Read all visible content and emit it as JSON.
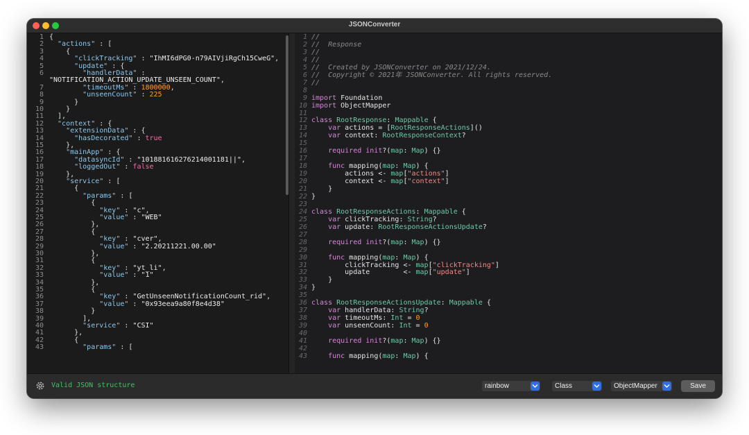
{
  "window": {
    "title": "JSONConverter"
  },
  "json_lines": [
    {
      "n": "1",
      "tokens": [
        {
          "c": "pun",
          "t": "{"
        }
      ]
    },
    {
      "n": "2",
      "tokens": [
        {
          "c": "key",
          "t": "  \"actions\""
        },
        {
          "c": "pun",
          "t": " : ["
        }
      ]
    },
    {
      "n": "3",
      "tokens": [
        {
          "c": "pun",
          "t": "    {"
        }
      ]
    },
    {
      "n": "4",
      "tokens": [
        {
          "c": "key",
          "t": "      \"clickTracking\""
        },
        {
          "c": "pun",
          "t": " : "
        },
        {
          "c": "str",
          "t": "\"IhMI6dPG0-n79AIVjiRgCh15CweG\""
        },
        {
          "c": "pun",
          "t": ","
        }
      ]
    },
    {
      "n": "5",
      "tokens": [
        {
          "c": "key",
          "t": "      \"update\""
        },
        {
          "c": "pun",
          "t": " : {"
        }
      ]
    },
    {
      "n": "6",
      "tokens": [
        {
          "c": "key",
          "t": "        \"handlerData\""
        },
        {
          "c": "pun",
          "t": " :"
        }
      ]
    },
    {
      "n": "",
      "tokens": [
        {
          "c": "str",
          "t": "\"NOTIFICATION_ACTION_UPDATE_UNSEEN_COUNT\""
        },
        {
          "c": "pun",
          "t": ","
        }
      ]
    },
    {
      "n": "7",
      "tokens": [
        {
          "c": "key",
          "t": "        \"timeoutMs\""
        },
        {
          "c": "pun",
          "t": " : "
        },
        {
          "c": "num",
          "t": "1800000"
        },
        {
          "c": "pun",
          "t": ","
        }
      ]
    },
    {
      "n": "8",
      "tokens": [
        {
          "c": "key",
          "t": "        \"unseenCount\""
        },
        {
          "c": "pun",
          "t": " : "
        },
        {
          "c": "num",
          "t": "225"
        }
      ]
    },
    {
      "n": "9",
      "tokens": [
        {
          "c": "pun",
          "t": "      }"
        }
      ]
    },
    {
      "n": "10",
      "tokens": [
        {
          "c": "pun",
          "t": "    }"
        }
      ]
    },
    {
      "n": "11",
      "tokens": [
        {
          "c": "pun",
          "t": "  ],"
        }
      ]
    },
    {
      "n": "12",
      "tokens": [
        {
          "c": "key",
          "t": "  \"context\""
        },
        {
          "c": "pun",
          "t": " : {"
        }
      ]
    },
    {
      "n": "13",
      "tokens": [
        {
          "c": "key",
          "t": "    \"extensionData\""
        },
        {
          "c": "pun",
          "t": " : {"
        }
      ]
    },
    {
      "n": "14",
      "tokens": [
        {
          "c": "key",
          "t": "      \"hasDecorated\""
        },
        {
          "c": "pun",
          "t": " : "
        },
        {
          "c": "lit",
          "t": "true"
        }
      ]
    },
    {
      "n": "15",
      "tokens": [
        {
          "c": "pun",
          "t": "    },"
        }
      ]
    },
    {
      "n": "16",
      "tokens": [
        {
          "c": "key",
          "t": "    \"mainApp\""
        },
        {
          "c": "pun",
          "t": " : {"
        }
      ]
    },
    {
      "n": "17",
      "tokens": [
        {
          "c": "key",
          "t": "      \"datasyncId\""
        },
        {
          "c": "pun",
          "t": " : "
        },
        {
          "c": "str",
          "t": "\"101881616276214001181||\""
        },
        {
          "c": "pun",
          "t": ","
        }
      ]
    },
    {
      "n": "18",
      "tokens": [
        {
          "c": "key",
          "t": "      \"loggedOut\""
        },
        {
          "c": "pun",
          "t": " : "
        },
        {
          "c": "lit",
          "t": "false"
        }
      ]
    },
    {
      "n": "19",
      "tokens": [
        {
          "c": "pun",
          "t": "    },"
        }
      ]
    },
    {
      "n": "20",
      "tokens": [
        {
          "c": "key",
          "t": "    \"service\""
        },
        {
          "c": "pun",
          "t": " : ["
        }
      ]
    },
    {
      "n": "21",
      "tokens": [
        {
          "c": "pun",
          "t": "      {"
        }
      ]
    },
    {
      "n": "22",
      "tokens": [
        {
          "c": "key",
          "t": "        \"params\""
        },
        {
          "c": "pun",
          "t": " : ["
        }
      ]
    },
    {
      "n": "23",
      "tokens": [
        {
          "c": "pun",
          "t": "          {"
        }
      ]
    },
    {
      "n": "24",
      "tokens": [
        {
          "c": "key",
          "t": "            \"key\""
        },
        {
          "c": "pun",
          "t": " : "
        },
        {
          "c": "str",
          "t": "\"c\""
        },
        {
          "c": "pun",
          "t": ","
        }
      ]
    },
    {
      "n": "25",
      "tokens": [
        {
          "c": "key",
          "t": "            \"value\""
        },
        {
          "c": "pun",
          "t": " : "
        },
        {
          "c": "str",
          "t": "\"WEB\""
        }
      ]
    },
    {
      "n": "26",
      "tokens": [
        {
          "c": "pun",
          "t": "          },"
        }
      ]
    },
    {
      "n": "27",
      "tokens": [
        {
          "c": "pun",
          "t": "          {"
        }
      ]
    },
    {
      "n": "28",
      "tokens": [
        {
          "c": "key",
          "t": "            \"key\""
        },
        {
          "c": "pun",
          "t": " : "
        },
        {
          "c": "str",
          "t": "\"cver\""
        },
        {
          "c": "pun",
          "t": ","
        }
      ]
    },
    {
      "n": "29",
      "tokens": [
        {
          "c": "key",
          "t": "            \"value\""
        },
        {
          "c": "pun",
          "t": " : "
        },
        {
          "c": "str",
          "t": "\"2.20211221.00.00\""
        }
      ]
    },
    {
      "n": "30",
      "tokens": [
        {
          "c": "pun",
          "t": "          },"
        }
      ]
    },
    {
      "n": "31",
      "tokens": [
        {
          "c": "pun",
          "t": "          {"
        }
      ]
    },
    {
      "n": "32",
      "tokens": [
        {
          "c": "key",
          "t": "            \"key\""
        },
        {
          "c": "pun",
          "t": " : "
        },
        {
          "c": "str",
          "t": "\"yt_li\""
        },
        {
          "c": "pun",
          "t": ","
        }
      ]
    },
    {
      "n": "33",
      "tokens": [
        {
          "c": "key",
          "t": "            \"value\""
        },
        {
          "c": "pun",
          "t": " : "
        },
        {
          "c": "str",
          "t": "\"1\""
        }
      ]
    },
    {
      "n": "34",
      "tokens": [
        {
          "c": "pun",
          "t": "          },"
        }
      ]
    },
    {
      "n": "35",
      "tokens": [
        {
          "c": "pun",
          "t": "          {"
        }
      ]
    },
    {
      "n": "36",
      "tokens": [
        {
          "c": "key",
          "t": "            \"key\""
        },
        {
          "c": "pun",
          "t": " : "
        },
        {
          "c": "str",
          "t": "\"GetUnseenNotificationCount_rid\""
        },
        {
          "c": "pun",
          "t": ","
        }
      ]
    },
    {
      "n": "37",
      "tokens": [
        {
          "c": "key",
          "t": "            \"value\""
        },
        {
          "c": "pun",
          "t": " : "
        },
        {
          "c": "str",
          "t": "\"0x93eea9a80f8e4d38\""
        }
      ]
    },
    {
      "n": "38",
      "tokens": [
        {
          "c": "pun",
          "t": "          }"
        }
      ]
    },
    {
      "n": "39",
      "tokens": [
        {
          "c": "pun",
          "t": "        ],"
        }
      ]
    },
    {
      "n": "40",
      "tokens": [
        {
          "c": "key",
          "t": "        \"service\""
        },
        {
          "c": "pun",
          "t": " : "
        },
        {
          "c": "str",
          "t": "\"CSI\""
        }
      ]
    },
    {
      "n": "41",
      "tokens": [
        {
          "c": "pun",
          "t": "      },"
        }
      ]
    },
    {
      "n": "42",
      "tokens": [
        {
          "c": "pun",
          "t": "      {"
        }
      ]
    },
    {
      "n": "43",
      "tokens": [
        {
          "c": "key",
          "t": "        \"params\""
        },
        {
          "c": "pun",
          "t": " : ["
        }
      ]
    }
  ],
  "code_lines": [
    {
      "n": "1",
      "tokens": [
        {
          "c": "cm",
          "t": "//"
        }
      ]
    },
    {
      "n": "2",
      "tokens": [
        {
          "c": "cm",
          "t": "//  Response"
        }
      ]
    },
    {
      "n": "3",
      "tokens": [
        {
          "c": "cm",
          "t": "//"
        }
      ]
    },
    {
      "n": "4",
      "tokens": [
        {
          "c": "cm",
          "t": "//"
        }
      ]
    },
    {
      "n": "5",
      "tokens": [
        {
          "c": "cm",
          "t": "//  Created by JSONConverter on 2021/12/24."
        }
      ]
    },
    {
      "n": "6",
      "tokens": [
        {
          "c": "cm",
          "t": "//  Copyright © 2021年 JSONConverter. All rights reserved."
        }
      ]
    },
    {
      "n": "7",
      "tokens": [
        {
          "c": "cm",
          "t": "//"
        }
      ]
    },
    {
      "n": "8",
      "tokens": []
    },
    {
      "n": "9",
      "tokens": [
        {
          "c": "kw",
          "t": "import"
        },
        {
          "c": "pl",
          "t": " Foundation"
        }
      ]
    },
    {
      "n": "10",
      "tokens": [
        {
          "c": "kw",
          "t": "import"
        },
        {
          "c": "pl",
          "t": " ObjectMapper"
        }
      ]
    },
    {
      "n": "11",
      "tokens": []
    },
    {
      "n": "12",
      "tokens": [
        {
          "c": "kw",
          "t": "class"
        },
        {
          "c": "ty",
          "t": " RootResponse"
        },
        {
          "c": "pl",
          "t": ": "
        },
        {
          "c": "ty",
          "t": "Mappable"
        },
        {
          "c": "pl",
          "t": " {"
        }
      ]
    },
    {
      "n": "13",
      "tokens": [
        {
          "c": "kw",
          "t": "    var"
        },
        {
          "c": "pl",
          "t": " actions = ["
        },
        {
          "c": "ty",
          "t": "RootResponseActions"
        },
        {
          "c": "pl",
          "t": "]()"
        }
      ]
    },
    {
      "n": "14",
      "tokens": [
        {
          "c": "kw",
          "t": "    var"
        },
        {
          "c": "pl",
          "t": " context: "
        },
        {
          "c": "ty",
          "t": "RootResponseContext"
        },
        {
          "c": "pl",
          "t": "?"
        }
      ]
    },
    {
      "n": "15",
      "tokens": []
    },
    {
      "n": "16",
      "tokens": [
        {
          "c": "kw",
          "t": "    required init"
        },
        {
          "c": "pl",
          "t": "?("
        },
        {
          "c": "ty",
          "t": "map"
        },
        {
          "c": "pl",
          "t": ": "
        },
        {
          "c": "ty",
          "t": "Map"
        },
        {
          "c": "pl",
          "t": ") {}"
        }
      ]
    },
    {
      "n": "17",
      "tokens": []
    },
    {
      "n": "18",
      "tokens": [
        {
          "c": "kw",
          "t": "    func"
        },
        {
          "c": "pl",
          "t": " mapping("
        },
        {
          "c": "ty",
          "t": "map"
        },
        {
          "c": "pl",
          "t": ": "
        },
        {
          "c": "ty",
          "t": "Map"
        },
        {
          "c": "pl",
          "t": ") {"
        }
      ]
    },
    {
      "n": "19",
      "tokens": [
        {
          "c": "pl",
          "t": "        actions <- "
        },
        {
          "c": "ty",
          "t": "map"
        },
        {
          "c": "pl",
          "t": "["
        },
        {
          "c": "ts",
          "t": "\"actions\""
        },
        {
          "c": "pl",
          "t": "]"
        }
      ]
    },
    {
      "n": "20",
      "tokens": [
        {
          "c": "pl",
          "t": "        context <- "
        },
        {
          "c": "ty",
          "t": "map"
        },
        {
          "c": "pl",
          "t": "["
        },
        {
          "c": "ts",
          "t": "\"context\""
        },
        {
          "c": "pl",
          "t": "]"
        }
      ]
    },
    {
      "n": "21",
      "tokens": [
        {
          "c": "pl",
          "t": "    }"
        }
      ]
    },
    {
      "n": "22",
      "tokens": [
        {
          "c": "pl",
          "t": "}"
        }
      ]
    },
    {
      "n": "23",
      "tokens": []
    },
    {
      "n": "24",
      "tokens": [
        {
          "c": "kw",
          "t": "class"
        },
        {
          "c": "ty",
          "t": " RootResponseActions"
        },
        {
          "c": "pl",
          "t": ": "
        },
        {
          "c": "ty",
          "t": "Mappable"
        },
        {
          "c": "pl",
          "t": " {"
        }
      ]
    },
    {
      "n": "25",
      "tokens": [
        {
          "c": "kw",
          "t": "    var"
        },
        {
          "c": "pl",
          "t": " clickTracking: "
        },
        {
          "c": "ty",
          "t": "String"
        },
        {
          "c": "pl",
          "t": "?"
        }
      ]
    },
    {
      "n": "26",
      "tokens": [
        {
          "c": "kw",
          "t": "    var"
        },
        {
          "c": "pl",
          "t": " update: "
        },
        {
          "c": "ty",
          "t": "RootResponseActionsUpdate"
        },
        {
          "c": "pl",
          "t": "?"
        }
      ]
    },
    {
      "n": "27",
      "tokens": []
    },
    {
      "n": "28",
      "tokens": [
        {
          "c": "kw",
          "t": "    required init"
        },
        {
          "c": "pl",
          "t": "?("
        },
        {
          "c": "ty",
          "t": "map"
        },
        {
          "c": "pl",
          "t": ": "
        },
        {
          "c": "ty",
          "t": "Map"
        },
        {
          "c": "pl",
          "t": ") {}"
        }
      ]
    },
    {
      "n": "29",
      "tokens": []
    },
    {
      "n": "30",
      "tokens": [
        {
          "c": "kw",
          "t": "    func"
        },
        {
          "c": "pl",
          "t": " mapping("
        },
        {
          "c": "ty",
          "t": "map"
        },
        {
          "c": "pl",
          "t": ": "
        },
        {
          "c": "ty",
          "t": "Map"
        },
        {
          "c": "pl",
          "t": ") {"
        }
      ]
    },
    {
      "n": "31",
      "tokens": [
        {
          "c": "pl",
          "t": "        clickTracking <- "
        },
        {
          "c": "ty",
          "t": "map"
        },
        {
          "c": "pl",
          "t": "["
        },
        {
          "c": "ts",
          "t": "\"clickTracking\""
        },
        {
          "c": "pl",
          "t": "]"
        }
      ]
    },
    {
      "n": "32",
      "tokens": [
        {
          "c": "pl",
          "t": "        update        <- "
        },
        {
          "c": "ty",
          "t": "map"
        },
        {
          "c": "pl",
          "t": "["
        },
        {
          "c": "ts",
          "t": "\"update\""
        },
        {
          "c": "pl",
          "t": "]"
        }
      ]
    },
    {
      "n": "33",
      "tokens": [
        {
          "c": "pl",
          "t": "    }"
        }
      ]
    },
    {
      "n": "34",
      "tokens": [
        {
          "c": "pl",
          "t": "}"
        }
      ]
    },
    {
      "n": "35",
      "tokens": []
    },
    {
      "n": "36",
      "tokens": [
        {
          "c": "kw",
          "t": "class"
        },
        {
          "c": "ty",
          "t": " RootResponseActionsUpdate"
        },
        {
          "c": "pl",
          "t": ": "
        },
        {
          "c": "ty",
          "t": "Mappable"
        },
        {
          "c": "pl",
          "t": " {"
        }
      ]
    },
    {
      "n": "37",
      "tokens": [
        {
          "c": "kw",
          "t": "    var"
        },
        {
          "c": "pl",
          "t": " handlerData: "
        },
        {
          "c": "ty",
          "t": "String"
        },
        {
          "c": "pl",
          "t": "?"
        }
      ]
    },
    {
      "n": "38",
      "tokens": [
        {
          "c": "kw",
          "t": "    var"
        },
        {
          "c": "pl",
          "t": " timeoutMs: "
        },
        {
          "c": "ty",
          "t": "Int"
        },
        {
          "c": "pl",
          "t": " = "
        },
        {
          "c": "tn",
          "t": "0"
        }
      ]
    },
    {
      "n": "39",
      "tokens": [
        {
          "c": "kw",
          "t": "    var"
        },
        {
          "c": "pl",
          "t": " unseenCount: "
        },
        {
          "c": "ty",
          "t": "Int"
        },
        {
          "c": "pl",
          "t": " = "
        },
        {
          "c": "tn",
          "t": "0"
        }
      ]
    },
    {
      "n": "40",
      "tokens": []
    },
    {
      "n": "41",
      "tokens": [
        {
          "c": "kw",
          "t": "    required init"
        },
        {
          "c": "pl",
          "t": "?("
        },
        {
          "c": "ty",
          "t": "map"
        },
        {
          "c": "pl",
          "t": ": "
        },
        {
          "c": "ty",
          "t": "Map"
        },
        {
          "c": "pl",
          "t": ") {}"
        }
      ]
    },
    {
      "n": "42",
      "tokens": []
    },
    {
      "n": "43",
      "tokens": [
        {
          "c": "kw",
          "t": "    func"
        },
        {
          "c": "pl",
          "t": " mapping("
        },
        {
          "c": "ty",
          "t": "map"
        },
        {
          "c": "pl",
          "t": ": "
        },
        {
          "c": "ty",
          "t": "Map"
        },
        {
          "c": "pl",
          "t": ") {"
        }
      ]
    }
  ],
  "bottom_bar": {
    "settings_icon": "gear-icon",
    "status": "Valid JSON structure",
    "theme_select": "rainbow",
    "type_select": "Class",
    "framework_select": "ObjectMapper",
    "save_label": "Save"
  },
  "colors": {
    "accent": "#2f6ee5",
    "valid_status": "#43c266",
    "json_key": "#8fc8ea",
    "number": "#ff9d3b",
    "keyword": "#d787d7",
    "type": "#76c5a8",
    "string_literal": "#ee8a8a"
  }
}
